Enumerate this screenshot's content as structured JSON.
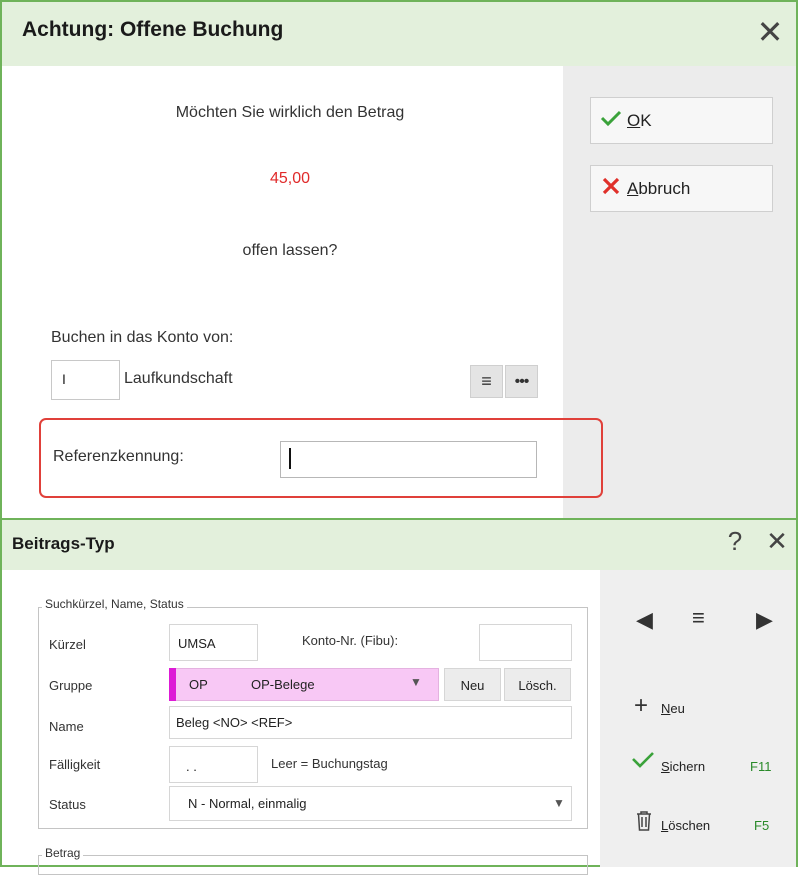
{
  "dialog1": {
    "title": "Achtung: Offene Buchung",
    "close_icon": "close-icon",
    "message_question": "Möchten Sie wirklich den Betrag",
    "message_amount": "45,00",
    "message_open": "offen lassen?",
    "konto_label": "Buchen in das Konto von:",
    "konto_code": "I",
    "konto_name": "Laufkundschaft",
    "reference_label": "Referenzkennung:",
    "reference_value": "",
    "ok_button": {
      "access_key": "O",
      "rest": "K",
      "icon": "check-icon"
    },
    "cancel_button": {
      "access_key": "A",
      "rest": "bbruch",
      "icon": "cross-icon"
    },
    "colors": {
      "amount": "#e02a2a",
      "highlight": "#e0403a",
      "title_bg": "#e3f0dc",
      "border": "#6fb35a"
    }
  },
  "dialog2": {
    "title": "Beitrags-Typ",
    "help_symbol": "?",
    "group_search_title": "Suchkürzel, Name, Status",
    "group_amount_title": "Betrag",
    "fields": {
      "kuerzel_label": "Kürzel",
      "kuerzel_value": "UMSA",
      "konto_nr_label": "Konto-Nr. (Fibu):",
      "konto_nr_value": "",
      "gruppe_label": "Gruppe",
      "gruppe_code": "OP",
      "gruppe_name": "OP-Belege",
      "neu_button": "Neu",
      "loesch_button": "Lösch.",
      "name_label": "Name",
      "name_value": "Beleg <NO> <REF>",
      "faelligkeit_label": "Fälligkeit",
      "faelligkeit_value": ". .",
      "faelligkeit_hint": "Leer = Buchungstag",
      "status_label": "Status",
      "status_value": "N - Normal, einmalig"
    },
    "actions": {
      "new": {
        "access_key": "N",
        "rest": "eu",
        "icon": "plus-icon"
      },
      "save": {
        "access_key": "S",
        "rest": "ichern",
        "shortcut": "F11",
        "icon": "check-icon"
      },
      "delete": {
        "access_key": "L",
        "rest": "öschen",
        "shortcut": "F5",
        "icon": "trash-icon"
      }
    },
    "colors": {
      "gruppe_bg": "#f8c8f5",
      "gruppe_marker": "#dd1ad6",
      "shortcut": "#2a8a2a"
    }
  }
}
